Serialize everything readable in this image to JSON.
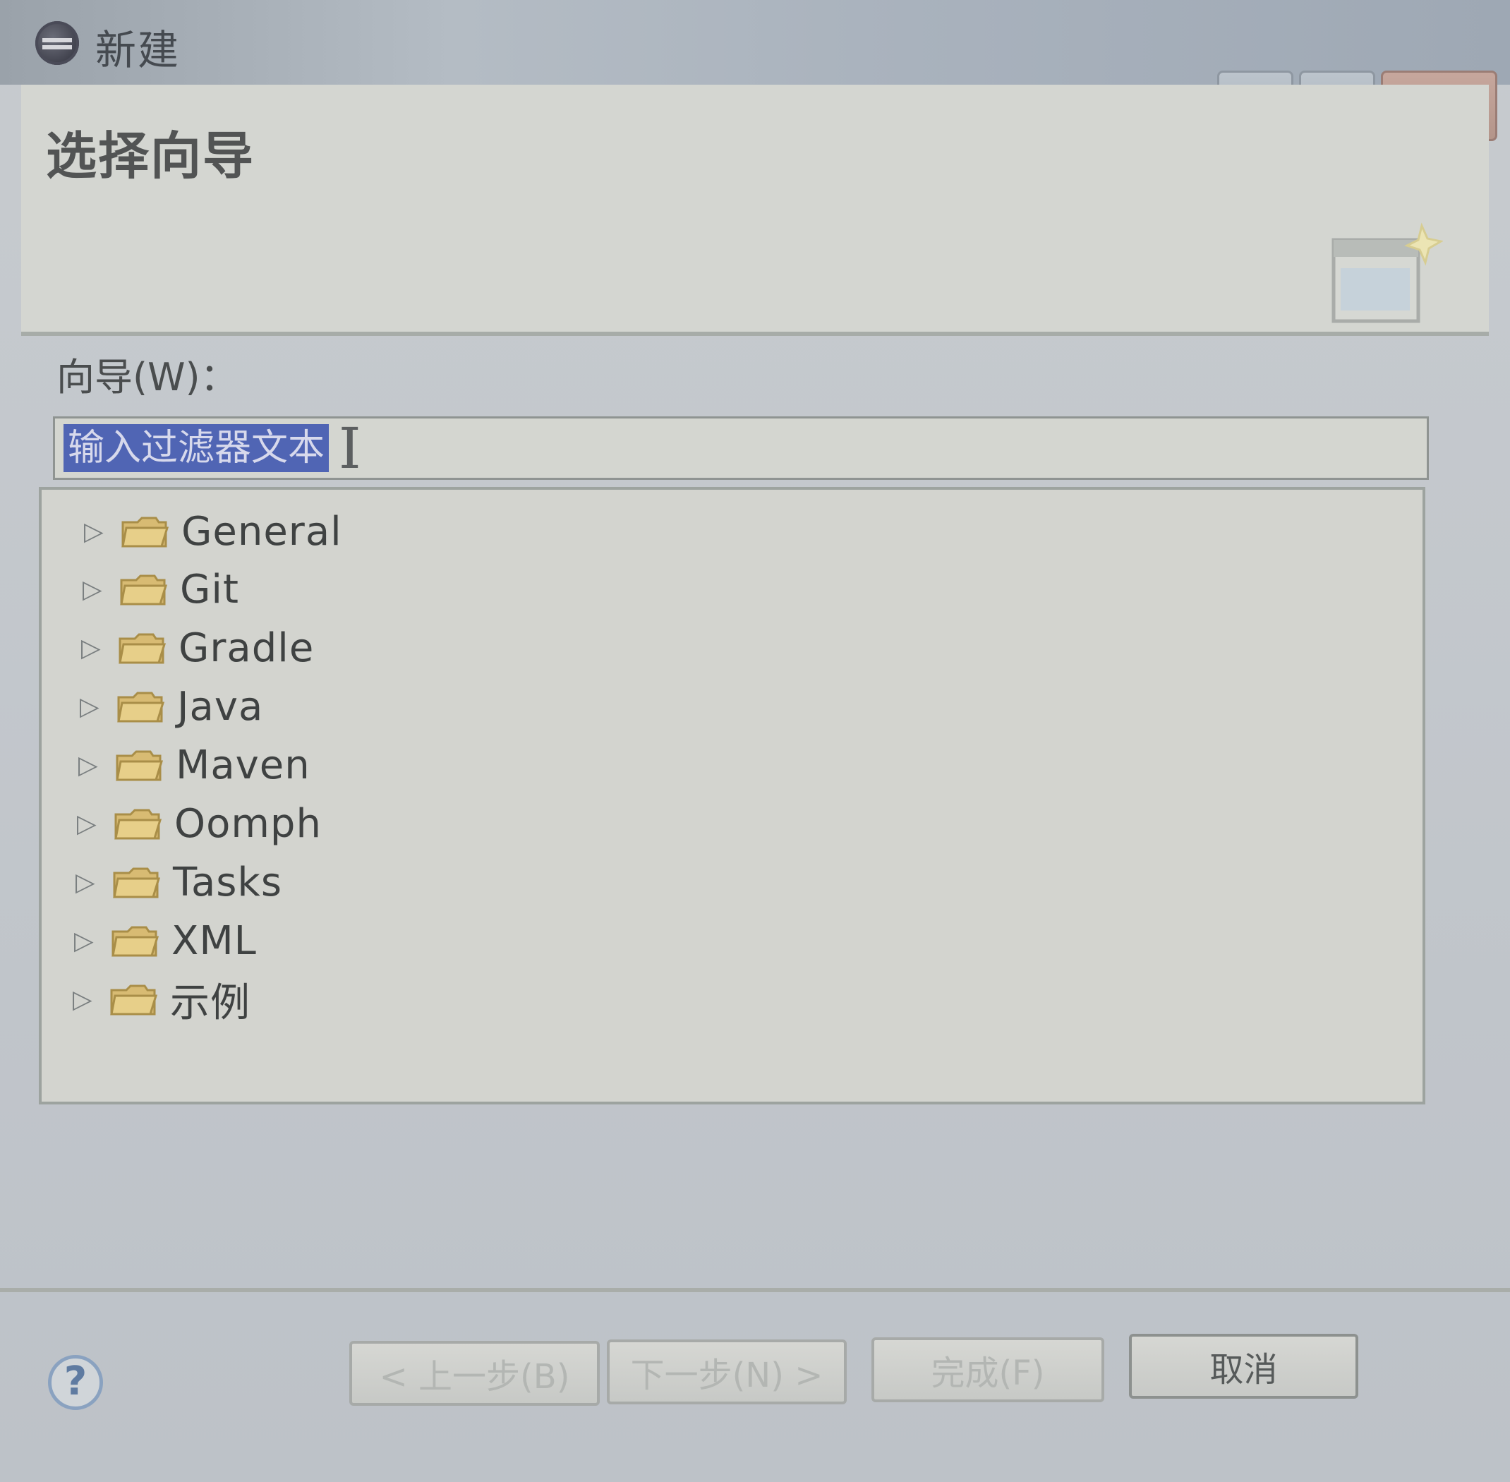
{
  "window": {
    "title": "新建",
    "close_symbol": "✕"
  },
  "header": {
    "title": "选择向导"
  },
  "wizards": {
    "label": "向导(W)：",
    "filter_text": "输入过滤器文本",
    "cursor_symbol": "I",
    "items": [
      {
        "label": "General"
      },
      {
        "label": "Git"
      },
      {
        "label": "Gradle"
      },
      {
        "label": "Java"
      },
      {
        "label": "Maven"
      },
      {
        "label": "Oomph"
      },
      {
        "label": "Tasks"
      },
      {
        "label": "XML"
      },
      {
        "label": "示例"
      }
    ]
  },
  "footer": {
    "help_symbol": "?",
    "back_label": "< 上一步(B)",
    "next_label": "下一步(N) >",
    "finish_label": "完成(F)",
    "cancel_label": "取消"
  },
  "colors": {
    "selection": "#5065b4",
    "folder": "#d8bb73"
  },
  "icons": {
    "app": "eclipse-icon",
    "help": "help-icon",
    "wizard_banner": "new-wizard-icon",
    "tree_expand": "expand-arrow-icon",
    "tree_folder": "folder-icon"
  }
}
